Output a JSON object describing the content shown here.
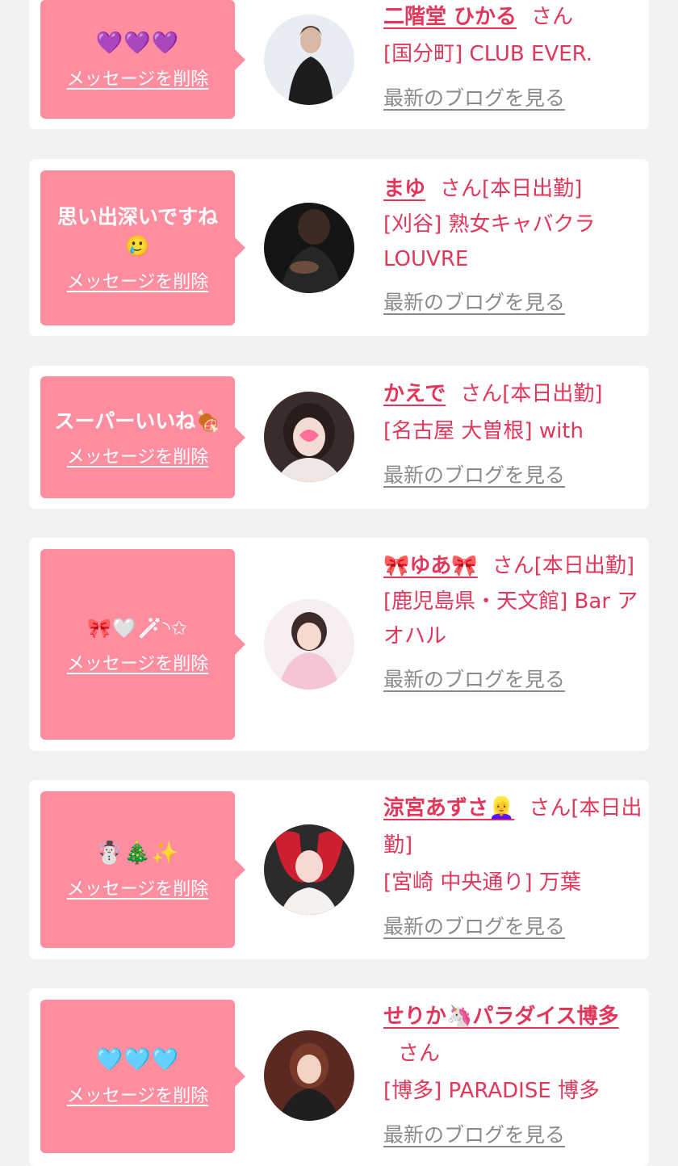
{
  "delete_label": "メッセージを削除",
  "blog_label": "最新のブログを見る",
  "san_label": "さん",
  "items": [
    {
      "message": "💜💜💜",
      "name": "二階堂 ひかる",
      "status": "",
      "shop": "[国分町] CLUB EVER."
    },
    {
      "message": "思い出深いですね🥲",
      "name": "まゆ",
      "status": "[本日出勤]",
      "shop": "[刈谷] 熟女キャバクラLOUVRE"
    },
    {
      "message": "スーパーいいね🍖",
      "name": "かえで",
      "status": "[本日出勤]",
      "shop": "[名古屋 大曽根] with"
    },
    {
      "message": "🎀🤍🪄︎︎◝✩",
      "name": "🎀ゆあ🎀",
      "status": "[本日出勤]",
      "shop": "[鹿児島県・天文館] Bar アオハル"
    },
    {
      "message": "☃️🎄✨",
      "name": "涼宮あずさ👱‍♀️",
      "status": "[本日出勤]",
      "shop": "[宮崎 中央通り] 万葉"
    },
    {
      "message": "🩵🩵🩵",
      "name": "せりか🦄パラダイス博多",
      "status": "",
      "shop": "[博多] PARADISE 博多"
    }
  ]
}
